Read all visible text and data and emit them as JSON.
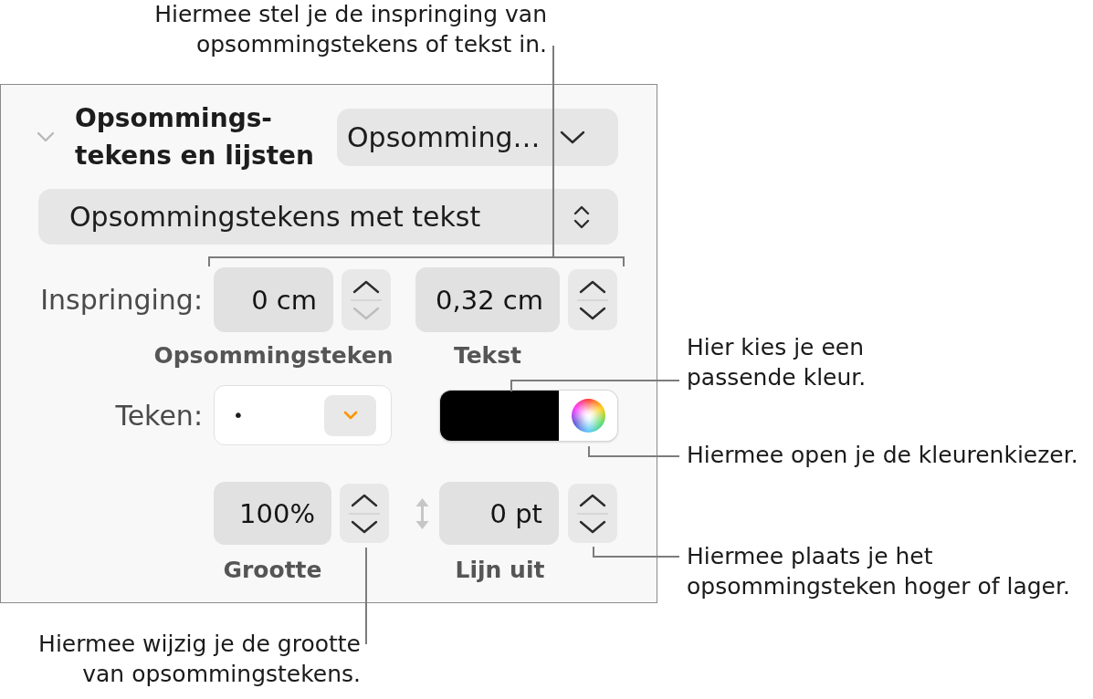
{
  "callouts": [
    {
      "text": "Hiermee stel je de inspringing van\nopsommingstekens of tekst in."
    },
    {
      "text": "Hier kies je een\npassende kleur."
    },
    {
      "text": "Hiermee open je de kleurenkiezer."
    },
    {
      "text": "Hiermee plaats je het\nopsommingsteken hoger of lager."
    },
    {
      "text": "Hiermee wijzig je de grootte\nvan opsommingstekens."
    }
  ],
  "panel": {
    "title": "Opsommings-\ntekens en lijsten",
    "expanded": true,
    "preset": "Opsomming…",
    "list_type": "Opsommingstekens met tekst",
    "indent": {
      "label": "Inspringing:",
      "fields": [
        {
          "value": "0 cm",
          "caption": "Opsommingsteken",
          "up_disabled": false,
          "down_disabled": true
        },
        {
          "value": "0,32 cm",
          "caption": "Tekst",
          "up_disabled": false,
          "down_disabled": false
        }
      ]
    },
    "bullet": {
      "label": "Teken:",
      "value": "•",
      "color": "#000000"
    },
    "size": {
      "fields": [
        {
          "kind": "size",
          "value": "100%",
          "caption": "Grootte",
          "up_disabled": false,
          "down_disabled": false
        },
        {
          "kind": "offset",
          "value": "0 pt",
          "caption": "Lijn uit",
          "up_disabled": false,
          "down_disabled": false
        }
      ]
    }
  }
}
